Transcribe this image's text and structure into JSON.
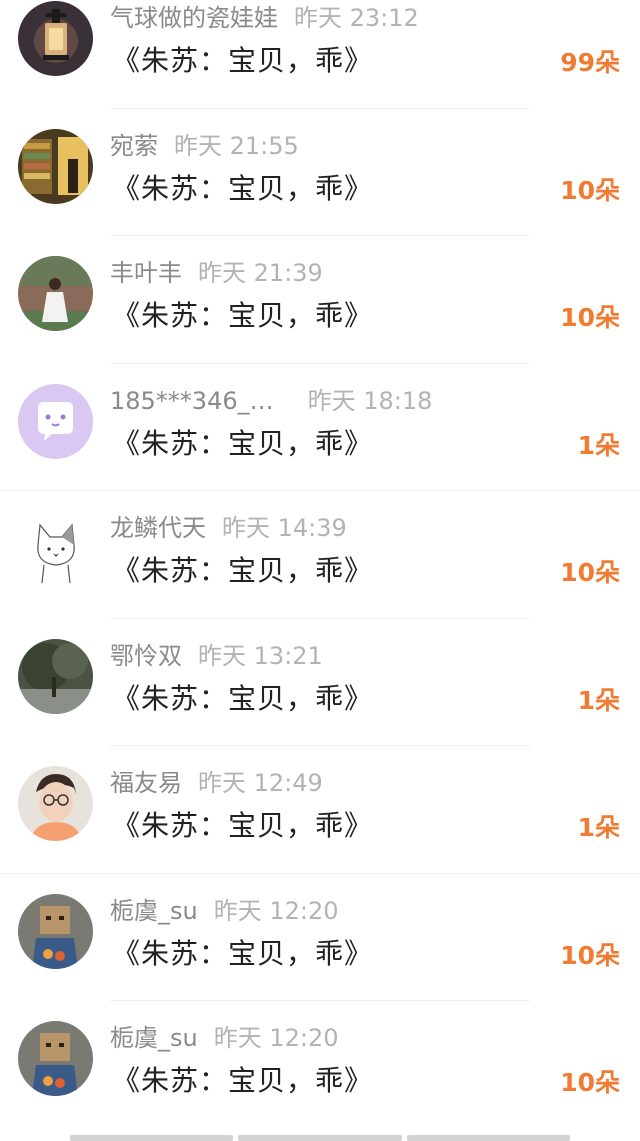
{
  "items": [
    {
      "name": "气球做的瓷娃娃",
      "time": "昨天 23:12",
      "title": "《朱苏：宝贝，乖》",
      "count": "99朵",
      "avatar": "lantern-avatar"
    },
    {
      "name": "宛萦",
      "time": "昨天 21:55",
      "title": "《朱苏：宝贝，乖》",
      "count": "10朵",
      "avatar": "bookstore-avatar"
    },
    {
      "name": "丰叶丰",
      "time": "昨天 21:39",
      "title": "《朱苏：宝贝，乖》",
      "count": "10朵",
      "avatar": "girl-in-white-avatar"
    },
    {
      "name": "185***346_…",
      "time": "昨天 18:18",
      "title": "《朱苏：宝贝，乖》",
      "count": "1朵",
      "avatar": "default-chat-bubble-avatar"
    },
    {
      "name": "龙鳞代天",
      "time": "昨天 14:39",
      "title": "《朱苏：宝贝，乖》",
      "count": "10朵",
      "avatar": "cat-sketch-avatar"
    },
    {
      "name": "鄂怜双",
      "time": "昨天 13:21",
      "title": "《朱苏：宝贝，乖》",
      "count": "1朵",
      "avatar": "tree-avatar"
    },
    {
      "name": "福友易",
      "time": "昨天 12:49",
      "title": "《朱苏：宝贝，乖》",
      "count": "1朵",
      "avatar": "boy-glasses-avatar"
    },
    {
      "name": "栀虞_su",
      "time": "昨天 12:20",
      "title": "《朱苏：宝贝，乖》",
      "count": "10朵",
      "avatar": "box-head-avatar"
    },
    {
      "name": "栀虞_su",
      "time": "昨天 12:20",
      "title": "《朱苏：宝贝，乖》",
      "count": "10朵",
      "avatar": "box-head-avatar"
    }
  ],
  "colors": {
    "accent": "#f07b33",
    "name": "#8a8a8a",
    "time": "#b3b3b3",
    "title": "#222222",
    "default_avatar_bg": "#d9c8f2"
  }
}
